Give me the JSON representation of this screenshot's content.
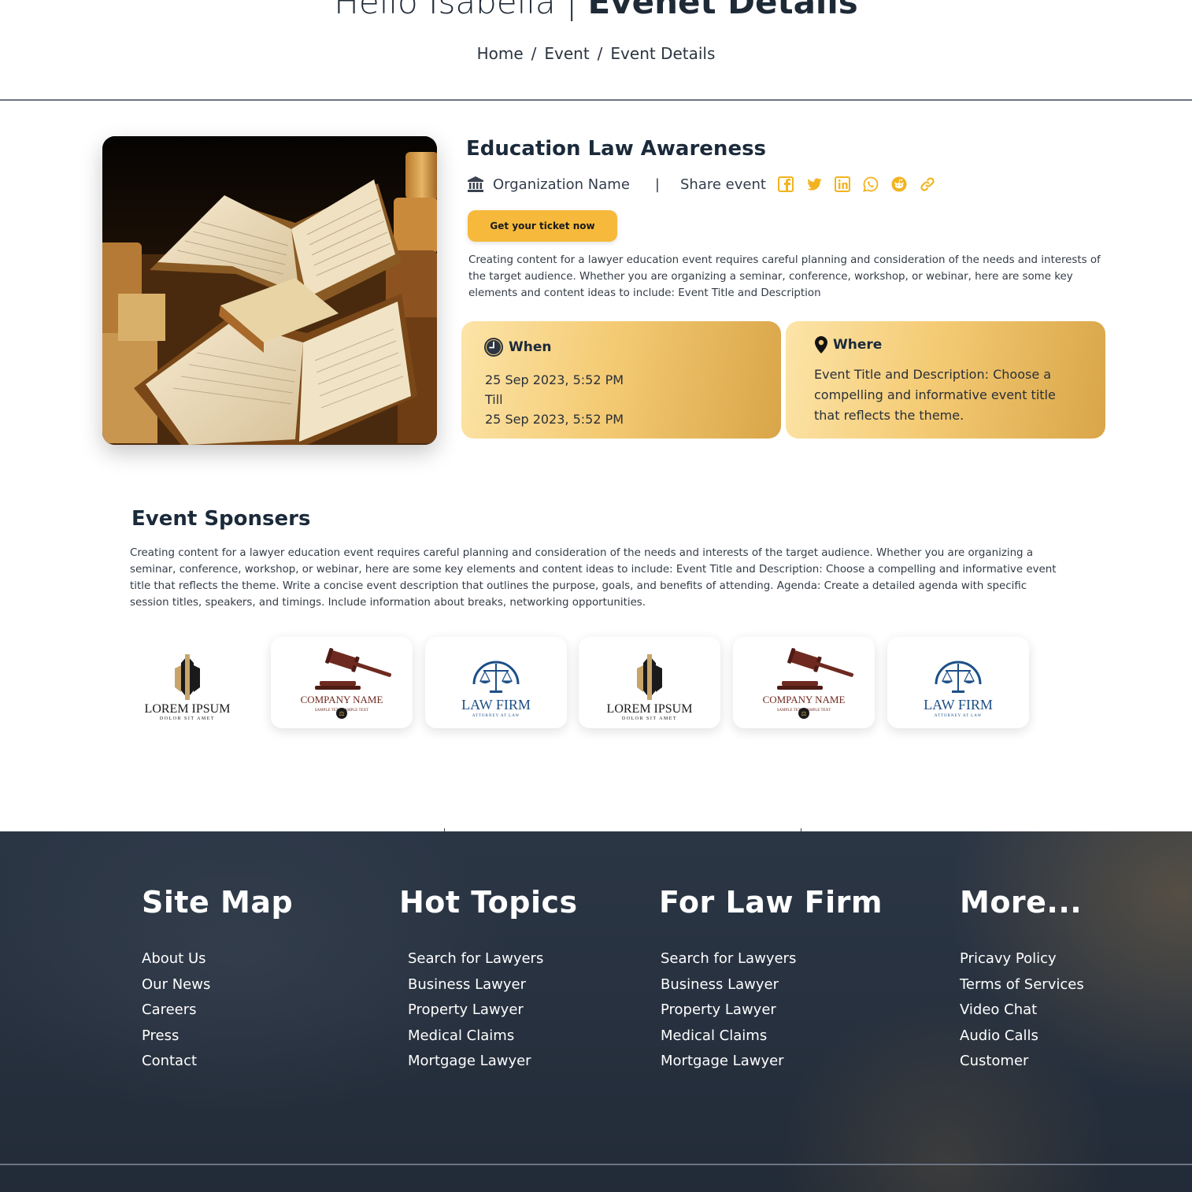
{
  "header": {
    "title_greeting": "Hello Isabella |",
    "title_page": "Evenet Details",
    "breadcrumb": [
      "Home",
      "Event",
      "Event Details"
    ]
  },
  "event": {
    "title": "Education Law Awareness",
    "organization": "Organization Name",
    "share_label": "Share event",
    "share_icons": [
      "facebook-icon",
      "twitter-icon",
      "linkedin-icon",
      "whatsapp-icon",
      "reddit-icon",
      "link-icon"
    ],
    "ticket_button": "Get your ticket now",
    "description": "Creating content for a lawyer education event requires careful planning and consideration of the needs and interests of the target audience. Whether you are organizing a seminar, conference, workshop, or webinar, here are some key elements and content ideas to include: Event Title and Description",
    "when": {
      "heading": "When",
      "start": "25 Sep 2023,  5:52 PM",
      "till": "Till",
      "end": "25 Sep 2023,  5:52 PM"
    },
    "where": {
      "heading": "Where",
      "text": "Event Title and Description: Choose a compelling and informative event title that reflects the theme."
    }
  },
  "sponsors": {
    "title": "Event Sponsers",
    "description": "Creating content for a lawyer education event requires careful planning and consideration of the needs and interests of the target audience. Whether you are organizing a seminar, conference, workshop, or webinar, here are some key elements and content ideas to include: Event Title and Description: Choose a compelling and informative event title that reflects the theme. Write a concise event description that outlines the purpose, goals, and benefits of attending. Agenda: Create a detailed agenda with specific session titles, speakers, and timings. Include information about breaks, networking opportunities.",
    "logos": [
      {
        "type": "lorem",
        "name": "LOREM IPSUM",
        "sub": "DOLOR SIT AMET"
      },
      {
        "type": "gavel",
        "name": "COMPANY NAME",
        "sub": "SAMPLE TEXT  SAMPLE TEXT"
      },
      {
        "type": "scales",
        "name": "LAW FIRM",
        "sub": "ATTORNEY AT LAW"
      },
      {
        "type": "lorem",
        "name": "LOREM IPSUM",
        "sub": "DOLOR SIT AMET"
      },
      {
        "type": "gavel",
        "name": "COMPANY NAME",
        "sub": "SAMPLE TEXT  SAMPLE TEXT"
      },
      {
        "type": "scales",
        "name": "LAW FIRM",
        "sub": "ATTORNEY AT LAW"
      }
    ]
  },
  "footer": {
    "columns": [
      {
        "title": "Site Map",
        "items": [
          "About Us",
          "Our News",
          "Careers",
          "Press",
          "Contact"
        ]
      },
      {
        "title": "Hot Topics",
        "items": [
          "Search for Lawyers",
          "Business Lawyer",
          "Property Lawyer",
          "Medical Claims",
          "Mortgage Lawyer"
        ]
      },
      {
        "title": "For Law Firm",
        "items": [
          "Search for Lawyers",
          "Business Lawyer",
          "Property Lawyer",
          "Medical Claims",
          "Mortgage Lawyer"
        ]
      },
      {
        "title": "More...",
        "items": [
          "Pricavy Policy",
          "Terms of Services",
          "Video Chat",
          "Audio Calls",
          "Customer"
        ]
      }
    ]
  },
  "colors": {
    "accent": "#f6b93b",
    "share_icon": "#f2b320",
    "heading": "#1b2a3a",
    "footer_bg": "#27313f"
  }
}
